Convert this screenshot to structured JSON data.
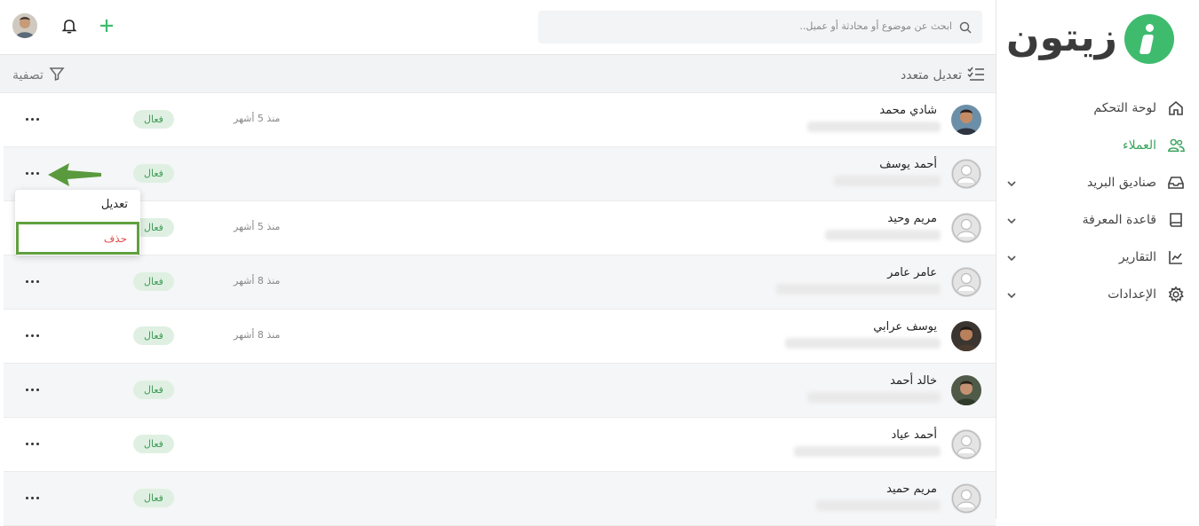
{
  "app": {
    "logo_text": "زيتون"
  },
  "search": {
    "placeholder": "ابحث عن موضوع أو محادثة أو عميل.."
  },
  "toolbar": {
    "bulk_edit_label": "تعديل متعدد",
    "filter_label": "تصفية"
  },
  "sidebar": {
    "items": [
      {
        "label": "لوحة التحكم",
        "icon": "home-icon",
        "active": false,
        "expandable": false
      },
      {
        "label": "العملاء",
        "icon": "users-icon",
        "active": true,
        "expandable": false
      },
      {
        "label": "صناديق البريد",
        "icon": "inbox-icon",
        "active": false,
        "expandable": true
      },
      {
        "label": "قاعدة المعرفة",
        "icon": "book-icon",
        "active": false,
        "expandable": true
      },
      {
        "label": "التقارير",
        "icon": "chart-icon",
        "active": false,
        "expandable": true
      },
      {
        "label": "الإعدادات",
        "icon": "gear-icon",
        "active": false,
        "expandable": true
      }
    ]
  },
  "customers": [
    {
      "name": "شادي محمد",
      "time": "منذ 5 أشهر",
      "status": "فعال",
      "avatar": "photo"
    },
    {
      "name": "أحمد يوسف",
      "time": "",
      "status": "فعال",
      "avatar": "placeholder"
    },
    {
      "name": "مريم وحيد",
      "time": "منذ 5 أشهر",
      "status": "فعال",
      "avatar": "placeholder"
    },
    {
      "name": "عامر عامر",
      "time": "منذ 8 أشهر",
      "status": "فعال",
      "avatar": "placeholder"
    },
    {
      "name": "يوسف عرابي",
      "time": "منذ 8 أشهر",
      "status": "فعال",
      "avatar": "photo"
    },
    {
      "name": "خالد أحمد",
      "time": "",
      "status": "فعال",
      "avatar": "photo"
    },
    {
      "name": "أحمد عياد",
      "time": "",
      "status": "فعال",
      "avatar": "placeholder"
    },
    {
      "name": "مريم حميد",
      "time": "",
      "status": "فعال",
      "avatar": "placeholder"
    }
  ],
  "row_menu": {
    "edit_label": "تعديل",
    "delete_label": "حذف"
  },
  "colors": {
    "brand": "#3fbb6e",
    "active_nav": "#3aa35c",
    "danger": "#e24c4c",
    "highlight": "#5fa03f"
  }
}
